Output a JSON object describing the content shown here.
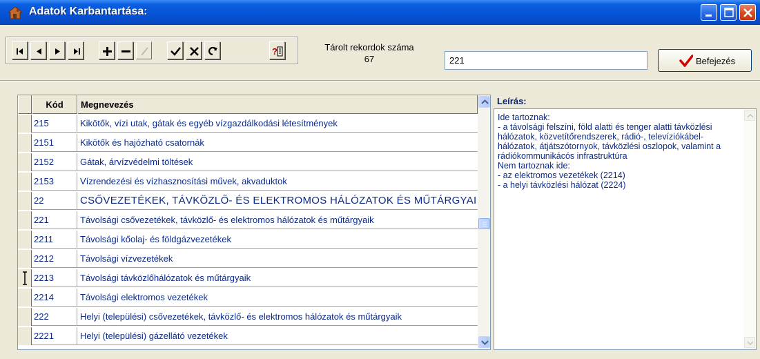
{
  "window": {
    "title": "Adatok Karbantartása:",
    "colors": {
      "titlebar": "#0653d6",
      "close": "#d64b1f"
    }
  },
  "toolbar": {
    "buttons": [
      {
        "name": "first-record",
        "glyph": "|◀"
      },
      {
        "name": "prior-record",
        "glyph": "◀"
      },
      {
        "name": "next-record",
        "glyph": "▶"
      },
      {
        "name": "last-record",
        "glyph": "▶|"
      },
      {
        "name": "insert-record",
        "glyph": "+"
      },
      {
        "name": "delete-record",
        "glyph": "−"
      },
      {
        "name": "edit-record",
        "glyph": "edit",
        "disabled": true
      },
      {
        "name": "post-record",
        "glyph": "✓"
      },
      {
        "name": "cancel-edit",
        "glyph": "✕"
      },
      {
        "name": "refresh-data",
        "glyph": "refresh"
      },
      {
        "name": "help",
        "glyph": "?"
      }
    ],
    "count_label": "Tárolt rekordok száma",
    "count_value": "67",
    "search_value": "221",
    "finish_label": "Befejezés"
  },
  "grid": {
    "columns": [
      "Kód",
      "Megnevezés"
    ],
    "rows": [
      {
        "kod": "215",
        "nev": "Kikötők, vízi utak, gátak és egyéb vízgazdálkodási létesítmények"
      },
      {
        "kod": "2151",
        "nev": "Kikötők és hajózható csatornák"
      },
      {
        "kod": "2152",
        "nev": "Gátak, árvízvédelmi töltések"
      },
      {
        "kod": "2153",
        "nev": "Vízrendezési és vízhasznosítási művek, akvaduktok"
      },
      {
        "kod": "22",
        "nev": "CSŐVEZETÉKEK, TÁVKÖZLŐ- ÉS ELEKTROMOS HÁLÓZATOK ÉS MŰTÁRGYAI"
      },
      {
        "kod": "221",
        "nev": "Távolsági csővezetékek, távközlő- és elektromos hálózatok és műtárgyaik"
      },
      {
        "kod": "2211",
        "nev": "Távolsági kőolaj- és földgázvezetékek"
      },
      {
        "kod": "2212",
        "nev": "Távolsági vízvezetékek"
      },
      {
        "kod": "2213",
        "nev": "Távolsági távközlőhálózatok és műtárgyaik"
      },
      {
        "kod": "2214",
        "nev": "Távolsági elektromos vezetékek"
      },
      {
        "kod": "222",
        "nev": "Helyi (települési) csővezetékek, távközlő- és elektromos hálózatok és műtárgyaik"
      },
      {
        "kod": "2221",
        "nev": "Helyi (települési) gázellátó vezetékek"
      }
    ],
    "current_row_index": 8
  },
  "description": {
    "label": "Leírás:",
    "text": "Ide tartoznak:\n- a távolsági felszíni, föld alatti és tenger alatti távközlési hálózatok, közvetítőrendszerek, rádió-, televíziókábel-hálózatok, átjátszótornyok, távközlési oszlopok, valamint a rádiókommunikácós infrastruktúra\nNem tartoznak ide:\n- az elektromos vezetékek (2214)\n- a helyi távközlési hálózat (2224)"
  }
}
